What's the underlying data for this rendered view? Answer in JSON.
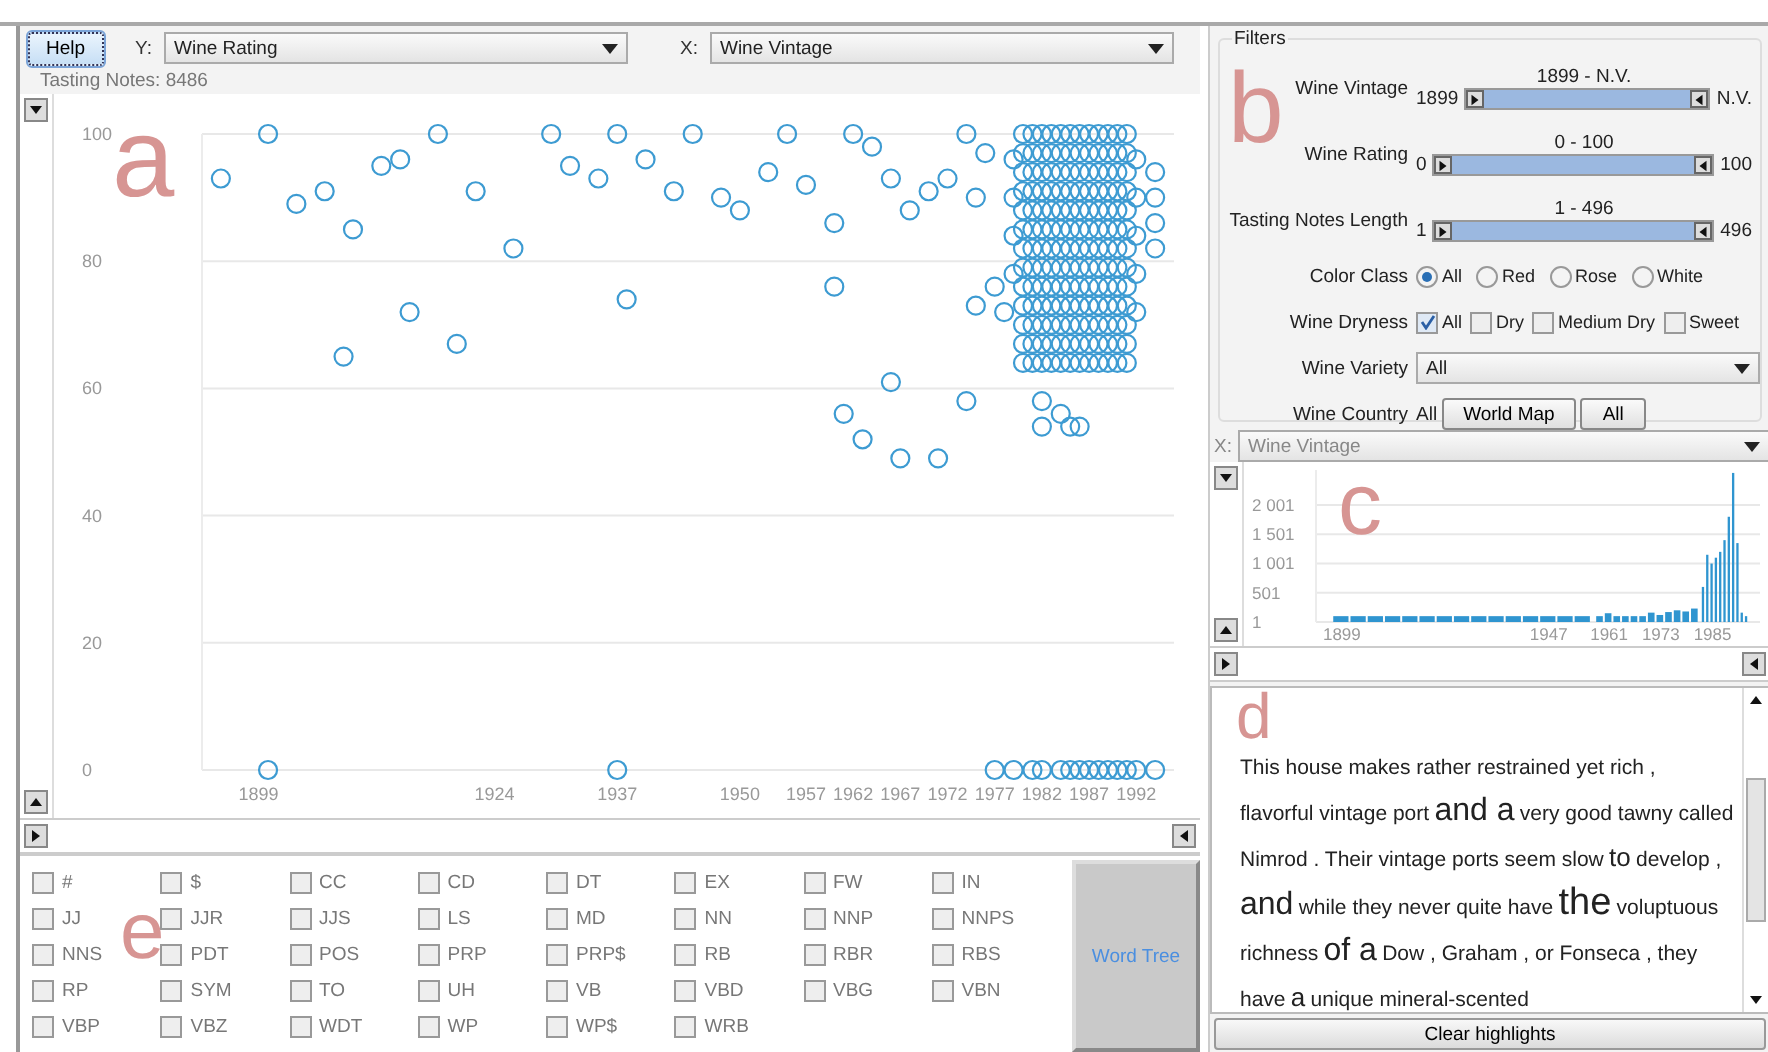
{
  "toolbar": {
    "help": "Help",
    "y_label": "Y:",
    "y_value": "Wine Rating",
    "x_label": "X:",
    "x_value": "Wine Vintage"
  },
  "count": "Tasting Notes: 8486",
  "scatter": {
    "annotation": "a",
    "chart_data": {
      "type": "scatter",
      "xlim": [
        1893,
        1996
      ],
      "xticks": [
        1899,
        1924,
        1937,
        1950,
        1957,
        1962,
        1967,
        1972,
        1977,
        1982,
        1987,
        1992
      ],
      "yticks": [
        0,
        20,
        40,
        60,
        80,
        100
      ],
      "ylim": [
        0,
        100
      ],
      "grid": true,
      "x": [
        1895,
        1900,
        1903,
        1906,
        1909,
        1912,
        1914,
        1918,
        1922,
        1926,
        1930,
        1932,
        1935,
        1937,
        1940,
        1943,
        1945,
        1948,
        1950,
        1953,
        1955,
        1957,
        1960,
        1962,
        1964,
        1966,
        1968,
        1970,
        1972,
        1974,
        1975,
        1976,
        1915,
        1908,
        1920,
        1938,
        1960,
        1961,
        1963,
        1966,
        1967,
        1971,
        1974,
        1975,
        1977,
        1978,
        1979,
        1979,
        1979,
        1979,
        1980,
        1980,
        1980,
        1980,
        1980,
        1980,
        1980,
        1980,
        1980,
        1980,
        1980,
        1980,
        1980,
        1981,
        1981,
        1981,
        1981,
        1981,
        1981,
        1981,
        1981,
        1981,
        1981,
        1981,
        1981,
        1981,
        1982,
        1982,
        1982,
        1982,
        1982,
        1982,
        1982,
        1982,
        1982,
        1982,
        1982,
        1982,
        1982,
        1983,
        1983,
        1983,
        1983,
        1983,
        1983,
        1983,
        1983,
        1983,
        1983,
        1983,
        1983,
        1983,
        1984,
        1984,
        1984,
        1984,
        1984,
        1984,
        1984,
        1984,
        1984,
        1984,
        1984,
        1984,
        1984,
        1985,
        1985,
        1985,
        1985,
        1985,
        1985,
        1985,
        1985,
        1985,
        1985,
        1985,
        1985,
        1985,
        1986,
        1986,
        1986,
        1986,
        1986,
        1986,
        1986,
        1986,
        1986,
        1986,
        1986,
        1986,
        1986,
        1987,
        1987,
        1987,
        1987,
        1987,
        1987,
        1987,
        1987,
        1987,
        1987,
        1987,
        1987,
        1987,
        1988,
        1988,
        1988,
        1988,
        1988,
        1988,
        1988,
        1988,
        1988,
        1988,
        1988,
        1988,
        1988,
        1989,
        1989,
        1989,
        1989,
        1989,
        1989,
        1989,
        1989,
        1989,
        1989,
        1989,
        1989,
        1989,
        1990,
        1990,
        1990,
        1990,
        1990,
        1990,
        1990,
        1990,
        1990,
        1990,
        1990,
        1990,
        1990,
        1991,
        1991,
        1991,
        1991,
        1991,
        1991,
        1991,
        1991,
        1991,
        1991,
        1991,
        1991,
        1991,
        1992,
        1992,
        1992,
        1992,
        1992,
        1994,
        1994,
        1994,
        1994,
        1982,
        1982,
        1984,
        1985,
        1986,
        1900,
        1937,
        1977,
        1979,
        1981,
        1982,
        1984,
        1985,
        1986,
        1987,
        1988,
        1989,
        1990,
        1991,
        1992,
        1994
      ],
      "series": [
        {
          "color": "#3d9bd2",
          "values": [
            93,
            100,
            89,
            91,
            85,
            95,
            96,
            100,
            91,
            82,
            100,
            95,
            93,
            100,
            96,
            91,
            100,
            90,
            88,
            94,
            100,
            92,
            86,
            100,
            98,
            93,
            88,
            91,
            93,
            100,
            90,
            97,
            72,
            65,
            67,
            74,
            76,
            56,
            52,
            61,
            49,
            49,
            58,
            73,
            76,
            72,
            78,
            84,
            90,
            96,
            64,
            67,
            70,
            73,
            76,
            79,
            82,
            85,
            88,
            91,
            94,
            97,
            100,
            64,
            67,
            70,
            73,
            76,
            79,
            82,
            85,
            88,
            91,
            94,
            97,
            100,
            64,
            67,
            70,
            73,
            76,
            79,
            82,
            85,
            88,
            91,
            94,
            97,
            100,
            64,
            67,
            70,
            73,
            76,
            79,
            82,
            85,
            88,
            91,
            94,
            97,
            100,
            64,
            67,
            70,
            73,
            76,
            79,
            82,
            85,
            88,
            91,
            94,
            97,
            100,
            64,
            67,
            70,
            73,
            76,
            79,
            82,
            85,
            88,
            91,
            94,
            97,
            100,
            64,
            67,
            70,
            73,
            76,
            79,
            82,
            85,
            88,
            91,
            94,
            97,
            100,
            64,
            67,
            70,
            73,
            76,
            79,
            82,
            85,
            88,
            91,
            94,
            97,
            100,
            64,
            67,
            70,
            73,
            76,
            79,
            82,
            85,
            88,
            91,
            94,
            97,
            100,
            64,
            67,
            70,
            73,
            76,
            79,
            82,
            85,
            88,
            91,
            94,
            97,
            100,
            64,
            67,
            70,
            73,
            76,
            79,
            82,
            85,
            88,
            91,
            94,
            97,
            100,
            64,
            67,
            70,
            73,
            76,
            79,
            82,
            85,
            88,
            91,
            94,
            97,
            100,
            72,
            78,
            84,
            90,
            96,
            82,
            86,
            90,
            94,
            54,
            58,
            56,
            54,
            54,
            0,
            0,
            0,
            0,
            0,
            0,
            0,
            0,
            0,
            0,
            0,
            0,
            0,
            0,
            0,
            0
          ]
        }
      ]
    }
  },
  "pos_tags": [
    {
      "label": "#",
      "checked": false
    },
    {
      "label": "$",
      "checked": false
    },
    {
      "label": "CC",
      "checked": false
    },
    {
      "label": "CD",
      "checked": false
    },
    {
      "label": "DT",
      "checked": false
    },
    {
      "label": "EX",
      "checked": false
    },
    {
      "label": "FW",
      "checked": false
    },
    {
      "label": "IN",
      "checked": false
    },
    {
      "label": "JJ",
      "checked": false
    },
    {
      "label": "JJR",
      "checked": false
    },
    {
      "label": "JJS",
      "checked": false
    },
    {
      "label": "LS",
      "checked": false
    },
    {
      "label": "MD",
      "checked": false
    },
    {
      "label": "NN",
      "checked": false
    },
    {
      "label": "NNP",
      "checked": false
    },
    {
      "label": "NNPS",
      "checked": false
    },
    {
      "label": "NNS",
      "checked": false
    },
    {
      "label": "PDT",
      "checked": false
    },
    {
      "label": "POS",
      "checked": false
    },
    {
      "label": "PRP",
      "checked": false
    },
    {
      "label": "PRP$",
      "checked": false
    },
    {
      "label": "RB",
      "checked": false
    },
    {
      "label": "RBR",
      "checked": false
    },
    {
      "label": "RBS",
      "checked": false
    },
    {
      "label": "RP",
      "checked": false
    },
    {
      "label": "SYM",
      "checked": false
    },
    {
      "label": "TO",
      "checked": false
    },
    {
      "label": "UH",
      "checked": false
    },
    {
      "label": "VB",
      "checked": false
    },
    {
      "label": "VBD",
      "checked": false
    },
    {
      "label": "VBG",
      "checked": false
    },
    {
      "label": "VBN",
      "checked": false
    },
    {
      "label": "VBP",
      "checked": false
    },
    {
      "label": "VBZ",
      "checked": false
    },
    {
      "label": "WDT",
      "checked": false
    },
    {
      "label": "WP",
      "checked": false
    },
    {
      "label": "WP$",
      "checked": false
    },
    {
      "label": "WRB",
      "checked": false
    }
  ],
  "pos_annotation": "e",
  "word_tree": "Word Tree",
  "filters": {
    "title": "Filters",
    "annotation": "b",
    "sliders": [
      {
        "label": "Wine Vintage",
        "range": "1899 - N.V.",
        "min": "1899",
        "max": "N.V.",
        "level": 1
      },
      {
        "label": "Wine Rating",
        "range": "0 - 100",
        "min": "0",
        "max": "100",
        "level": 1
      },
      {
        "label": "Tasting Notes Length",
        "range": "1 - 496",
        "min": "1",
        "max": "496",
        "level": 1
      }
    ],
    "color_class": {
      "label": "Color Class",
      "options": [
        {
          "label": "All",
          "selected": true
        },
        {
          "label": "Red",
          "selected": false
        },
        {
          "label": "Rose",
          "selected": false
        },
        {
          "label": "White",
          "selected": false
        }
      ]
    },
    "dryness": {
      "label": "Wine Dryness",
      "options": [
        {
          "label": "All",
          "checked": true
        },
        {
          "label": "Dry",
          "checked": false
        },
        {
          "label": "Medium Dry",
          "checked": false
        },
        {
          "label": "Sweet",
          "checked": false
        }
      ]
    },
    "variety": {
      "label": "Wine Variety",
      "value": "All"
    },
    "country": {
      "label": "Wine Country",
      "value": "All",
      "buttons": [
        "World Map",
        "All"
      ]
    }
  },
  "histogram": {
    "x_label": "X:",
    "x_value": "Wine Vintage",
    "annotation": "c",
    "chart_data": {
      "type": "bar",
      "xlim": [
        1893,
        1996
      ],
      "ylim": [
        0,
        2600
      ],
      "grid": true,
      "x": [
        1899,
        1903,
        1907,
        1911,
        1915,
        1919,
        1923,
        1927,
        1931,
        1935,
        1939,
        1943,
        1947,
        1951,
        1955,
        1959,
        1961,
        1963,
        1965,
        1967,
        1969,
        1971,
        1973,
        1975,
        1977,
        1979,
        1981,
        1983,
        1984,
        1985,
        1986,
        1987,
        1988,
        1989,
        1990,
        1991,
        1992,
        1993
      ],
      "series": [
        {
          "color": "#2f95d0",
          "values": [
            100,
            100,
            100,
            100,
            100,
            100,
            100,
            100,
            100,
            100,
            100,
            100,
            100,
            100,
            100,
            100,
            150,
            100,
            100,
            100,
            100,
            160,
            120,
            170,
            200,
            180,
            230,
            600,
            1150,
            1000,
            1100,
            1200,
            1400,
            1800,
            2550,
            1350,
            160,
            100
          ]
        }
      ],
      "xticks": [
        1899,
        1947,
        1961,
        1973,
        1985
      ],
      "yticks": [
        {
          "value": 1,
          "label": "1"
        },
        {
          "value": 501,
          "label": "501"
        },
        {
          "value": 1001,
          "label": "1 001"
        },
        {
          "value": 1501,
          "label": "1 501"
        },
        {
          "value": 2001,
          "label": "2 001"
        }
      ]
    }
  },
  "notes": {
    "annotation": "d",
    "tokens": [
      {
        "text": "This house makes rather restrained yet rich ,",
        "kind": "plain"
      },
      {
        "text": "flavorful vintage port",
        "kind": "plain"
      },
      {
        "text": "and a",
        "kind": "medium"
      },
      {
        "text": "very good tawny called Nimrod . Their vintage ports seem slow",
        "kind": "plain"
      },
      {
        "text": "to",
        "kind": "small"
      },
      {
        "text": "develop ,",
        "kind": "plain"
      },
      {
        "text": "and",
        "kind": "medium"
      },
      {
        "text": "while they never quite have",
        "kind": "plain"
      },
      {
        "text": "the",
        "kind": "large"
      },
      {
        "text": "voluptuous richness",
        "kind": "plain"
      },
      {
        "text": "of a",
        "kind": "medium"
      },
      {
        "text": "Dow , Graham , or Fonseca , they have",
        "kind": "plain"
      },
      {
        "text": "a",
        "kind": "small"
      },
      {
        "text": "unique mineral-scented",
        "kind": "plain"
      }
    ]
  },
  "clear": "Clear highlights"
}
